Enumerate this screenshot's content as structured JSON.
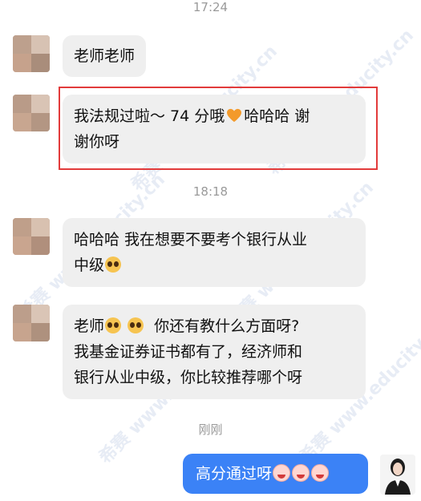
{
  "timestamps": [
    "17:24",
    "18:18",
    "刚刚"
  ],
  "messages": [
    {
      "text": "老师老师"
    },
    {
      "text_line1": "我法规过啦～ 74 分哦",
      "text_line1_suffix": "哈哈哈 谢",
      "text_line2": "谢你呀"
    },
    {
      "text_line1": "哈哈哈 我在想要不要考个银行从业",
      "text_line2": "中级"
    },
    {
      "text_line1_a": "老师",
      "text_line1_b": "你还有教什么方面呀?",
      "text_line2": "我基金证券证书都有了，经济师和",
      "text_line3": "银行从业中级，你比较推荐哪个呀"
    },
    {
      "text": "高分通过呀"
    }
  ],
  "watermark_text": "希赛 www.educity.cn",
  "colors": {
    "highlight": "#e23b3b",
    "outgoing": "#3b82f6",
    "incoming": "#efefef"
  }
}
